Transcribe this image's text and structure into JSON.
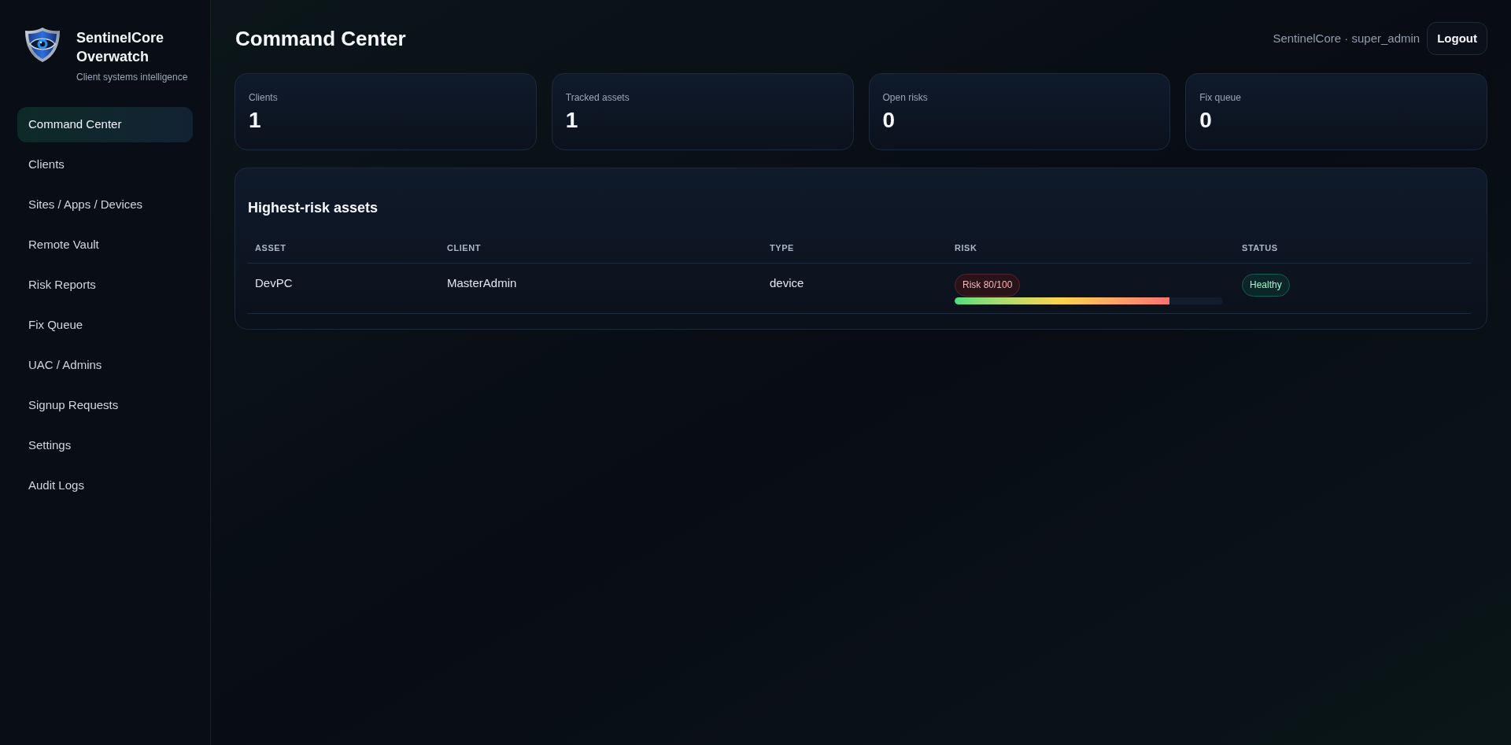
{
  "sidebar": {
    "brand": {
      "title": "SentinelCore Overwatch",
      "subtitle": "Client systems intelligence"
    },
    "nav": [
      {
        "label": "Command Center",
        "selected": true
      },
      {
        "label": "Clients",
        "selected": false
      },
      {
        "label": "Sites / Apps / Devices",
        "selected": false
      },
      {
        "label": "Remote Vault",
        "selected": false
      },
      {
        "label": "Risk Reports",
        "selected": false
      },
      {
        "label": "Fix Queue",
        "selected": false
      },
      {
        "label": "UAC / Admins",
        "selected": false
      },
      {
        "label": "Signup Requests",
        "selected": false
      },
      {
        "label": "Settings",
        "selected": false
      },
      {
        "label": "Audit Logs",
        "selected": false
      }
    ]
  },
  "header": {
    "title": "Command Center",
    "user": "SentinelCore · super_admin",
    "logout": "Logout"
  },
  "stats": [
    {
      "label": "Clients",
      "value": "1"
    },
    {
      "label": "Tracked assets",
      "value": "1"
    },
    {
      "label": "Open risks",
      "value": "0"
    },
    {
      "label": "Fix queue",
      "value": "0"
    }
  ],
  "panel": {
    "title": "Highest-risk assets",
    "table": {
      "columns": [
        "ASSET",
        "CLIENT",
        "TYPE",
        "RISK",
        "STATUS"
      ],
      "rows": [
        {
          "asset": "DevPC",
          "client": "MasterAdmin",
          "type": "device",
          "risk": {
            "label": "Risk 80/100",
            "level": 0.8
          },
          "status": {
            "label": "Healthy",
            "kind": "healthy"
          }
        }
      ]
    }
  }
}
